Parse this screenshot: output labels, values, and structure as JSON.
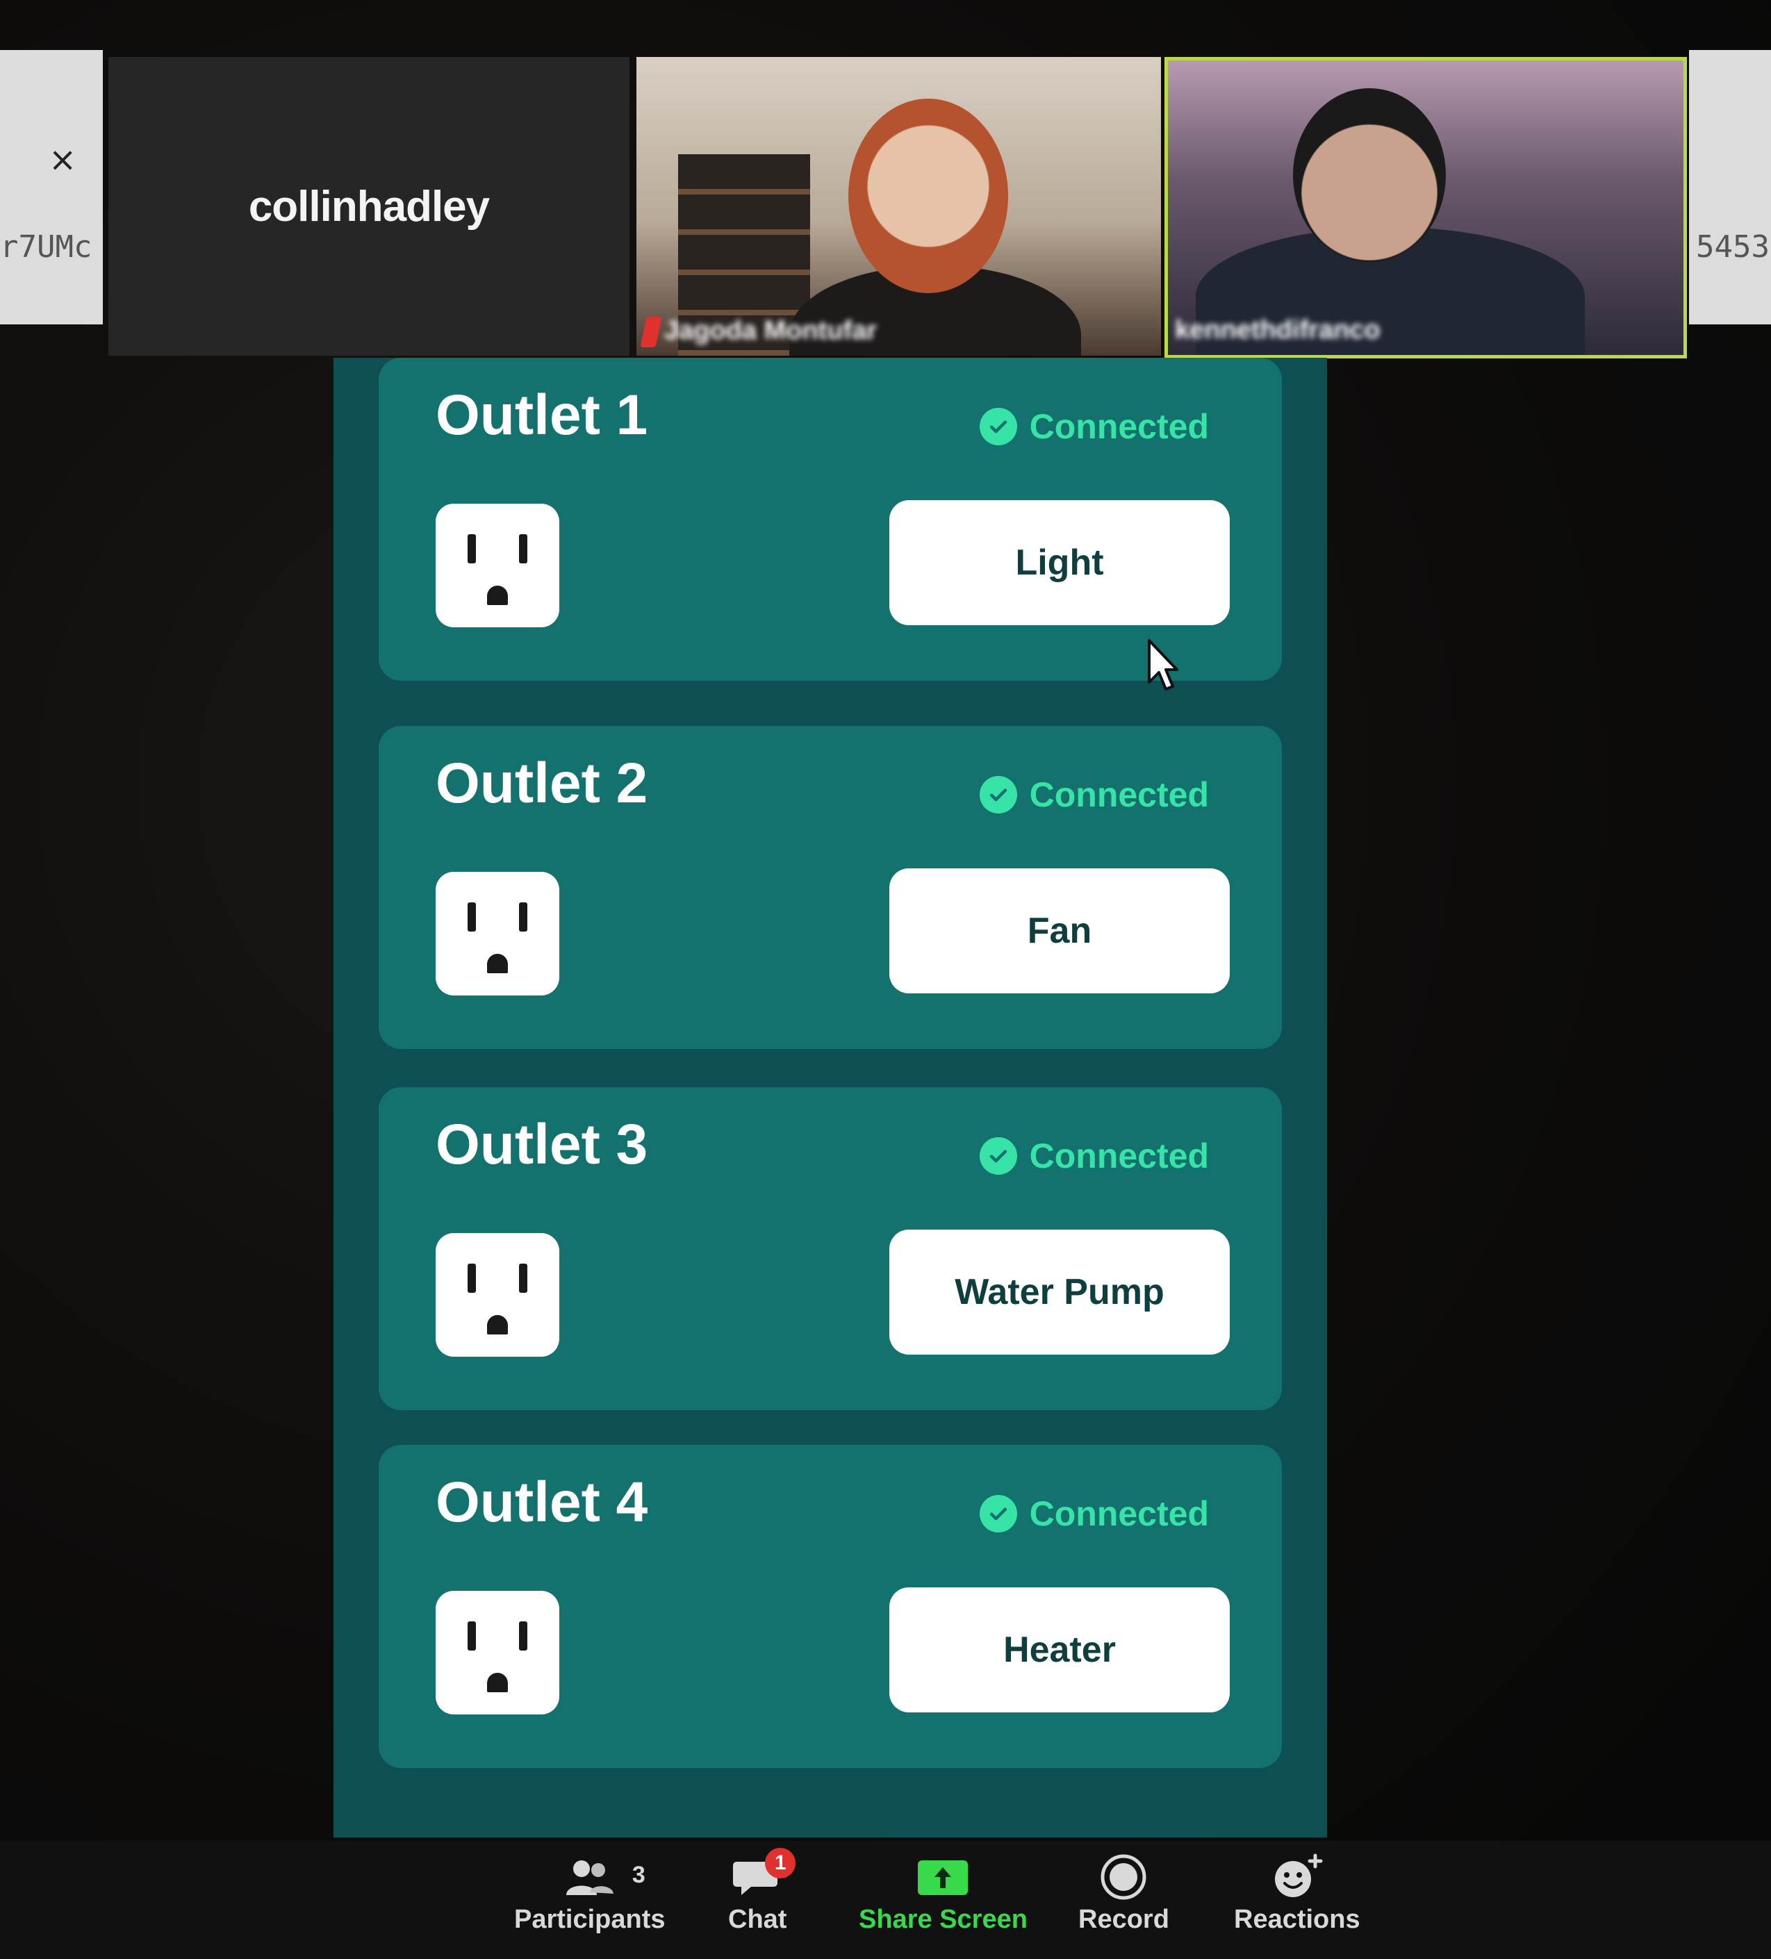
{
  "browser": {
    "close_symbol": "×",
    "left_url_fragment": "r7UMc",
    "right_url_fragment": "5453"
  },
  "participants_strip": {
    "name_tile_label": "collinhadley",
    "video_1_name": "Jagoda Montufar",
    "video_2_name": "kennethdifranco"
  },
  "outlets": [
    {
      "title": "Outlet 1",
      "status": "Connected",
      "device": "Light"
    },
    {
      "title": "Outlet 2",
      "status": "Connected",
      "device": "Fan"
    },
    {
      "title": "Outlet 3",
      "status": "Connected",
      "device": "Water Pump"
    },
    {
      "title": "Outlet 4",
      "status": "Connected",
      "device": "Heater"
    }
  ],
  "toolbar": {
    "participants_label": "Participants",
    "participants_count": "3",
    "chat_label": "Chat",
    "chat_badge": "1",
    "share_label": "Share Screen",
    "record_label": "Record",
    "reactions_label": "Reactions"
  },
  "colors": {
    "panel_bg": "#0d4f52",
    "card_bg": "#13726d",
    "status_green": "#37e3a7",
    "share_green": "#38d94a",
    "active_speaker_border": "#b9d84a"
  }
}
